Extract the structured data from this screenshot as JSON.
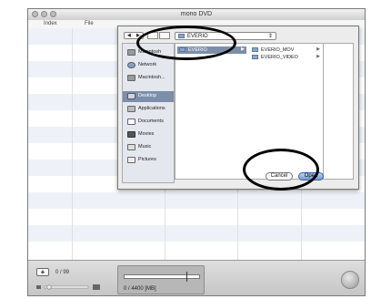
{
  "window": {
    "title": "mono DVD"
  },
  "columns": {
    "index": "Index",
    "file": "File"
  },
  "sheet": {
    "location_popup": "EVERIO",
    "sidebar": [
      {
        "label": "Macintosh",
        "icon": "hard-drive-icon"
      },
      {
        "label": "Network",
        "icon": "network-icon"
      },
      {
        "label": "Macintosh...",
        "icon": "hard-drive-icon"
      },
      {
        "label": "Desktop",
        "icon": "desktop-icon"
      },
      {
        "label": "Applications",
        "icon": "applications-icon"
      },
      {
        "label": "Documents",
        "icon": "documents-icon"
      },
      {
        "label": "Movies",
        "icon": "movies-icon"
      },
      {
        "label": "Music",
        "icon": "music-icon"
      },
      {
        "label": "Pictures",
        "icon": "pictures-icon"
      }
    ],
    "column1_items": [
      "EVERIO"
    ],
    "column2_items": [
      "EVERIO_MOV",
      "EVERIO_VIDEO"
    ],
    "cancel_label": "Cancel",
    "open_label": "Open"
  },
  "footer": {
    "add_label": "+",
    "count": "0 / 99",
    "capacity_text": "0 / 4400 [MB]",
    "capacity_fraction": 0
  }
}
